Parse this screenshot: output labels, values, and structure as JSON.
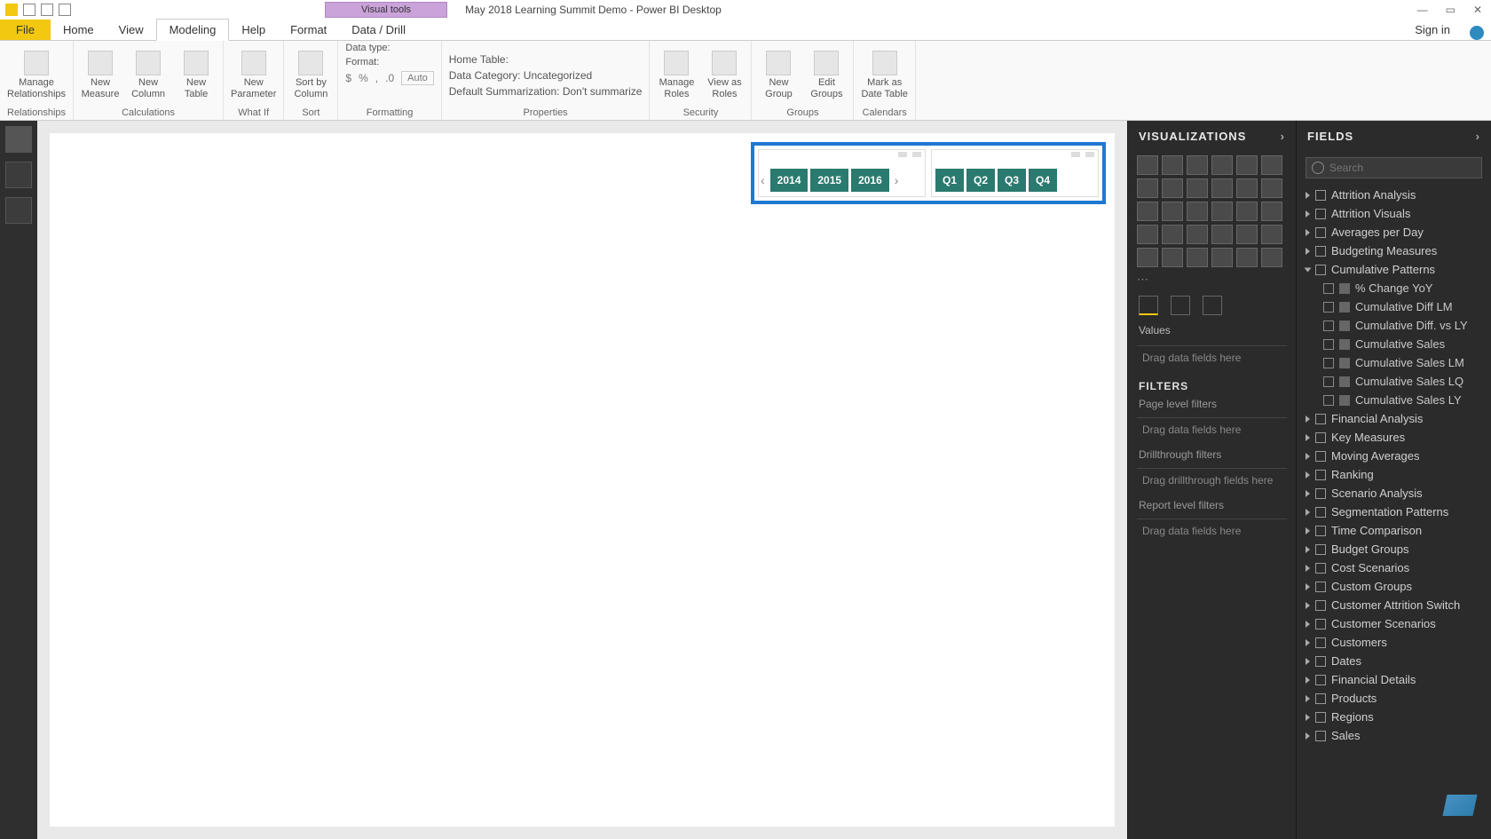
{
  "titlebar": {
    "visual_tools": "Visual tools",
    "doc_title": "May 2018 Learning Summit Demo - Power BI Desktop",
    "signin": "Sign in"
  },
  "tabs": {
    "file": "File",
    "home": "Home",
    "view": "View",
    "modeling": "Modeling",
    "help": "Help",
    "format": "Format",
    "datadrill": "Data / Drill"
  },
  "ribbon": {
    "relationships": {
      "manage": "Manage\nRelationships",
      "group": "Relationships"
    },
    "calculations": {
      "measure": "New\nMeasure",
      "column": "New\nColumn",
      "table": "New\nTable",
      "group": "Calculations"
    },
    "whatif": {
      "param": "New\nParameter",
      "group": "What If"
    },
    "sort": {
      "sortby": "Sort by\nColumn",
      "group": "Sort"
    },
    "formatting": {
      "datatype": "Data type:  ",
      "format": "Format:  ",
      "currency": "$",
      "percent": "%",
      "comma": ",",
      "auto": "Auto",
      "group": "Formatting"
    },
    "properties": {
      "hometable": "Home Table:  ",
      "datacat": "Data Category: Uncategorized",
      "summ": "Default Summarization: Don't summarize",
      "group": "Properties"
    },
    "security": {
      "manage": "Manage\nRoles",
      "viewas": "View as\nRoles",
      "group": "Security"
    },
    "groups": {
      "newg": "New\nGroup",
      "editg": "Edit\nGroups",
      "group": "Groups"
    },
    "calendars": {
      "mark": "Mark as\nDate Table",
      "group": "Calendars"
    }
  },
  "slicers": {
    "years": [
      "2014",
      "2015",
      "2016"
    ],
    "quarters": [
      "Q1",
      "Q2",
      "Q3",
      "Q4"
    ]
  },
  "vizpanel": {
    "title": "VISUALIZATIONS",
    "values": "Values",
    "dragfields": "Drag data fields here",
    "filters": "FILTERS",
    "pagefilters": "Page level filters",
    "drillfilters": "Drillthrough filters",
    "dragdrill": "Drag drillthrough fields here",
    "reportfilters": "Report level filters"
  },
  "fieldspanel": {
    "title": "FIELDS",
    "search_placeholder": "Search",
    "tables": [
      {
        "name": "Attrition Analysis",
        "open": false
      },
      {
        "name": "Attrition Visuals",
        "open": false
      },
      {
        "name": "Averages per Day",
        "open": false
      },
      {
        "name": "Budgeting Measures",
        "open": false
      },
      {
        "name": "Cumulative Patterns",
        "open": true,
        "fields": [
          "% Change YoY",
          "Cumulative Diff LM",
          "Cumulative Diff. vs LY",
          "Cumulative Sales",
          "Cumulative Sales LM",
          "Cumulative Sales LQ",
          "Cumulative Sales LY"
        ]
      },
      {
        "name": "Financial Analysis",
        "open": false
      },
      {
        "name": "Key Measures",
        "open": false
      },
      {
        "name": "Moving Averages",
        "open": false
      },
      {
        "name": "Ranking",
        "open": false
      },
      {
        "name": "Scenario Analysis",
        "open": false
      },
      {
        "name": "Segmentation Patterns",
        "open": false
      },
      {
        "name": "Time Comparison",
        "open": false
      },
      {
        "name": "Budget Groups",
        "open": false
      },
      {
        "name": "Cost Scenarios",
        "open": false
      },
      {
        "name": "Custom Groups",
        "open": false
      },
      {
        "name": "Customer Attrition Switch",
        "open": false
      },
      {
        "name": "Customer Scenarios",
        "open": false
      },
      {
        "name": "Customers",
        "open": false
      },
      {
        "name": "Dates",
        "open": false
      },
      {
        "name": "Financial Details",
        "open": false
      },
      {
        "name": "Products",
        "open": false
      },
      {
        "name": "Regions",
        "open": false
      },
      {
        "name": "Sales",
        "open": false
      }
    ]
  }
}
